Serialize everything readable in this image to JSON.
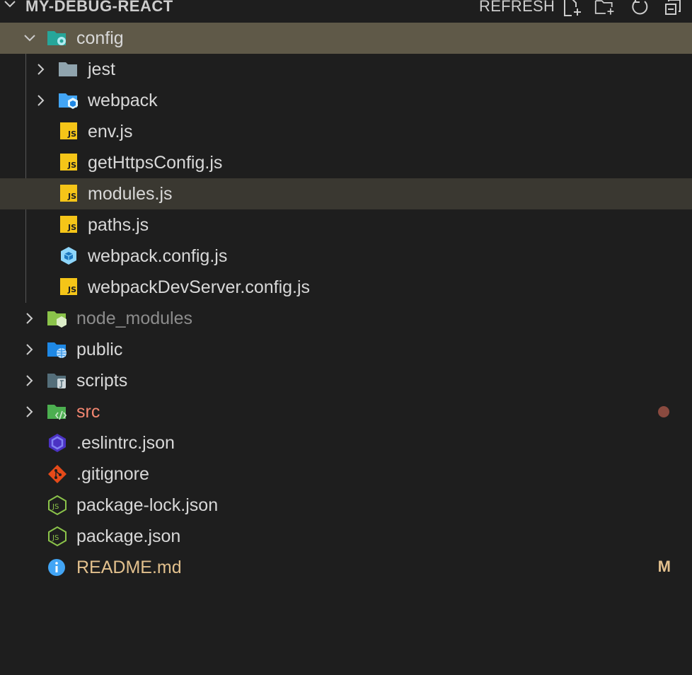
{
  "header": {
    "title": "MY-DEBUG-REACT",
    "refresh_label": "REFRESH"
  },
  "tree": [
    {
      "label": "config",
      "icon": "folder-config-icon",
      "kind": "folder",
      "expanded": true,
      "depth": 0
    },
    {
      "label": "jest",
      "icon": "folder-icon",
      "kind": "folder",
      "expanded": false,
      "depth": 1
    },
    {
      "label": "webpack",
      "icon": "folder-webpack-icon",
      "kind": "folder",
      "expanded": false,
      "depth": 1
    },
    {
      "label": "env.js",
      "icon": "js-file-icon",
      "kind": "file",
      "depth": 1
    },
    {
      "label": "getHttpsConfig.js",
      "icon": "js-file-icon",
      "kind": "file",
      "depth": 1
    },
    {
      "label": "modules.js",
      "icon": "js-file-icon",
      "kind": "file",
      "depth": 1
    },
    {
      "label": "paths.js",
      "icon": "js-file-icon",
      "kind": "file",
      "depth": 1
    },
    {
      "label": "webpack.config.js",
      "icon": "webpack-file-icon",
      "kind": "file",
      "depth": 1
    },
    {
      "label": "webpackDevServer.config.js",
      "icon": "js-file-icon",
      "kind": "file",
      "depth": 1
    },
    {
      "label": "node_modules",
      "icon": "folder-node-icon",
      "kind": "folder",
      "expanded": false,
      "depth": 0
    },
    {
      "label": "public",
      "icon": "folder-public-icon",
      "kind": "folder",
      "expanded": false,
      "depth": 0
    },
    {
      "label": "scripts",
      "icon": "folder-scripts-icon",
      "kind": "folder",
      "expanded": false,
      "depth": 0
    },
    {
      "label": "src",
      "icon": "folder-src-icon",
      "kind": "folder",
      "expanded": false,
      "depth": 0,
      "decoration": "dot"
    },
    {
      "label": ".eslintrc.json",
      "icon": "eslint-icon",
      "kind": "file",
      "depth": 0
    },
    {
      "label": ".gitignore",
      "icon": "git-icon",
      "kind": "file",
      "depth": 0
    },
    {
      "label": "package-lock.json",
      "icon": "nodejs-icon",
      "kind": "file",
      "depth": 0
    },
    {
      "label": "package.json",
      "icon": "nodejs-icon",
      "kind": "file",
      "depth": 0
    },
    {
      "label": "README.md",
      "icon": "info-icon",
      "kind": "file",
      "depth": 0,
      "badge": "M"
    }
  ],
  "colors": {
    "background": "#1e1e1e",
    "selected": "#5f5948",
    "hover": "#3a3831",
    "error": "#f48771",
    "modified": "#e2c08d",
    "js_yellow": "#f5c518",
    "folder_blue": "#42a5f5"
  }
}
